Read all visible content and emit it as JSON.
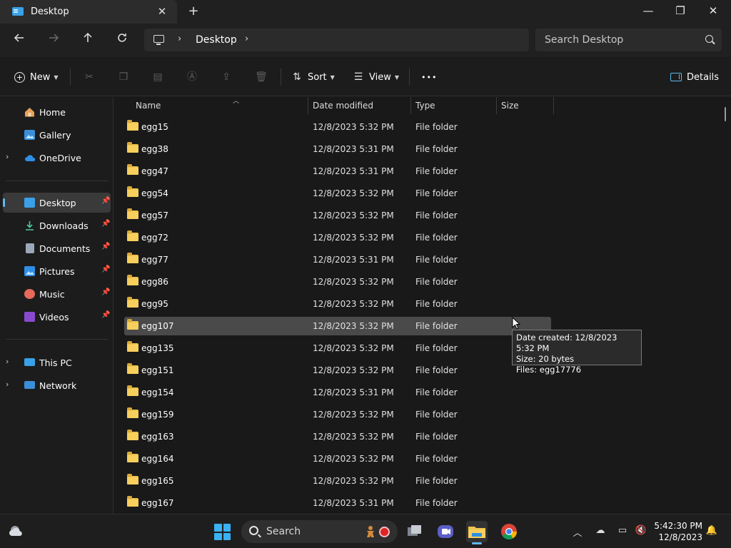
{
  "window": {
    "tab_title": "Desktop",
    "tab_close": "✕",
    "new_tab": "+",
    "minimize": "—",
    "maximize": "❐",
    "close": "✕"
  },
  "address": {
    "crumbs": [
      "Desktop"
    ],
    "separator": "›",
    "search_placeholder": "Search Desktop"
  },
  "toolbar": {
    "new_label": "New",
    "sort_label": "Sort",
    "view_label": "View",
    "more_label": "•••",
    "details_label": "Details"
  },
  "sidebar": {
    "items": [
      {
        "label": "Home",
        "icon": "home-icon"
      },
      {
        "label": "Gallery",
        "icon": "gallery-icon"
      },
      {
        "label": "OneDrive",
        "icon": "onedrive-icon"
      },
      {
        "label": "Desktop",
        "icon": "desktop-icon"
      },
      {
        "label": "Downloads",
        "icon": "downloads-icon"
      },
      {
        "label": "Documents",
        "icon": "documents-icon"
      },
      {
        "label": "Pictures",
        "icon": "pictures-icon"
      },
      {
        "label": "Music",
        "icon": "music-icon"
      },
      {
        "label": "Videos",
        "icon": "videos-icon"
      },
      {
        "label": "This PC",
        "icon": "this-pc-icon"
      },
      {
        "label": "Network",
        "icon": "network-icon"
      }
    ],
    "colors": {
      "accent": "#60b8f0"
    }
  },
  "filelist": {
    "columns": [
      "Name",
      "Date modified",
      "Type",
      "Size"
    ],
    "rows": [
      {
        "name": "egg15",
        "date": "12/8/2023 5:32 PM",
        "type": "File folder"
      },
      {
        "name": "egg38",
        "date": "12/8/2023 5:31 PM",
        "type": "File folder"
      },
      {
        "name": "egg47",
        "date": "12/8/2023 5:31 PM",
        "type": "File folder"
      },
      {
        "name": "egg54",
        "date": "12/8/2023 5:32 PM",
        "type": "File folder"
      },
      {
        "name": "egg57",
        "date": "12/8/2023 5:32 PM",
        "type": "File folder"
      },
      {
        "name": "egg72",
        "date": "12/8/2023 5:32 PM",
        "type": "File folder"
      },
      {
        "name": "egg77",
        "date": "12/8/2023 5:31 PM",
        "type": "File folder"
      },
      {
        "name": "egg86",
        "date": "12/8/2023 5:32 PM",
        "type": "File folder"
      },
      {
        "name": "egg95",
        "date": "12/8/2023 5:32 PM",
        "type": "File folder"
      },
      {
        "name": "egg107",
        "date": "12/8/2023 5:32 PM",
        "type": "File folder",
        "selected": true
      },
      {
        "name": "egg135",
        "date": "12/8/2023 5:32 PM",
        "type": "File folder"
      },
      {
        "name": "egg151",
        "date": "12/8/2023 5:32 PM",
        "type": "File folder"
      },
      {
        "name": "egg154",
        "date": "12/8/2023 5:31 PM",
        "type": "File folder"
      },
      {
        "name": "egg159",
        "date": "12/8/2023 5:32 PM",
        "type": "File folder"
      },
      {
        "name": "egg163",
        "date": "12/8/2023 5:32 PM",
        "type": "File folder"
      },
      {
        "name": "egg164",
        "date": "12/8/2023 5:32 PM",
        "type": "File folder"
      },
      {
        "name": "egg165",
        "date": "12/8/2023 5:32 PM",
        "type": "File folder"
      },
      {
        "name": "egg167",
        "date": "12/8/2023 5:31 PM",
        "type": "File folder"
      }
    ]
  },
  "tooltip": {
    "lines": [
      "Date created: 12/8/2023 5:32 PM",
      "Size: 20 bytes",
      "Files: egg17776"
    ]
  },
  "taskbar": {
    "search_label": "Search",
    "clock_time": "5:42:30 PM",
    "clock_date": "12/8/2023",
    "tray_chevron": "︿"
  }
}
